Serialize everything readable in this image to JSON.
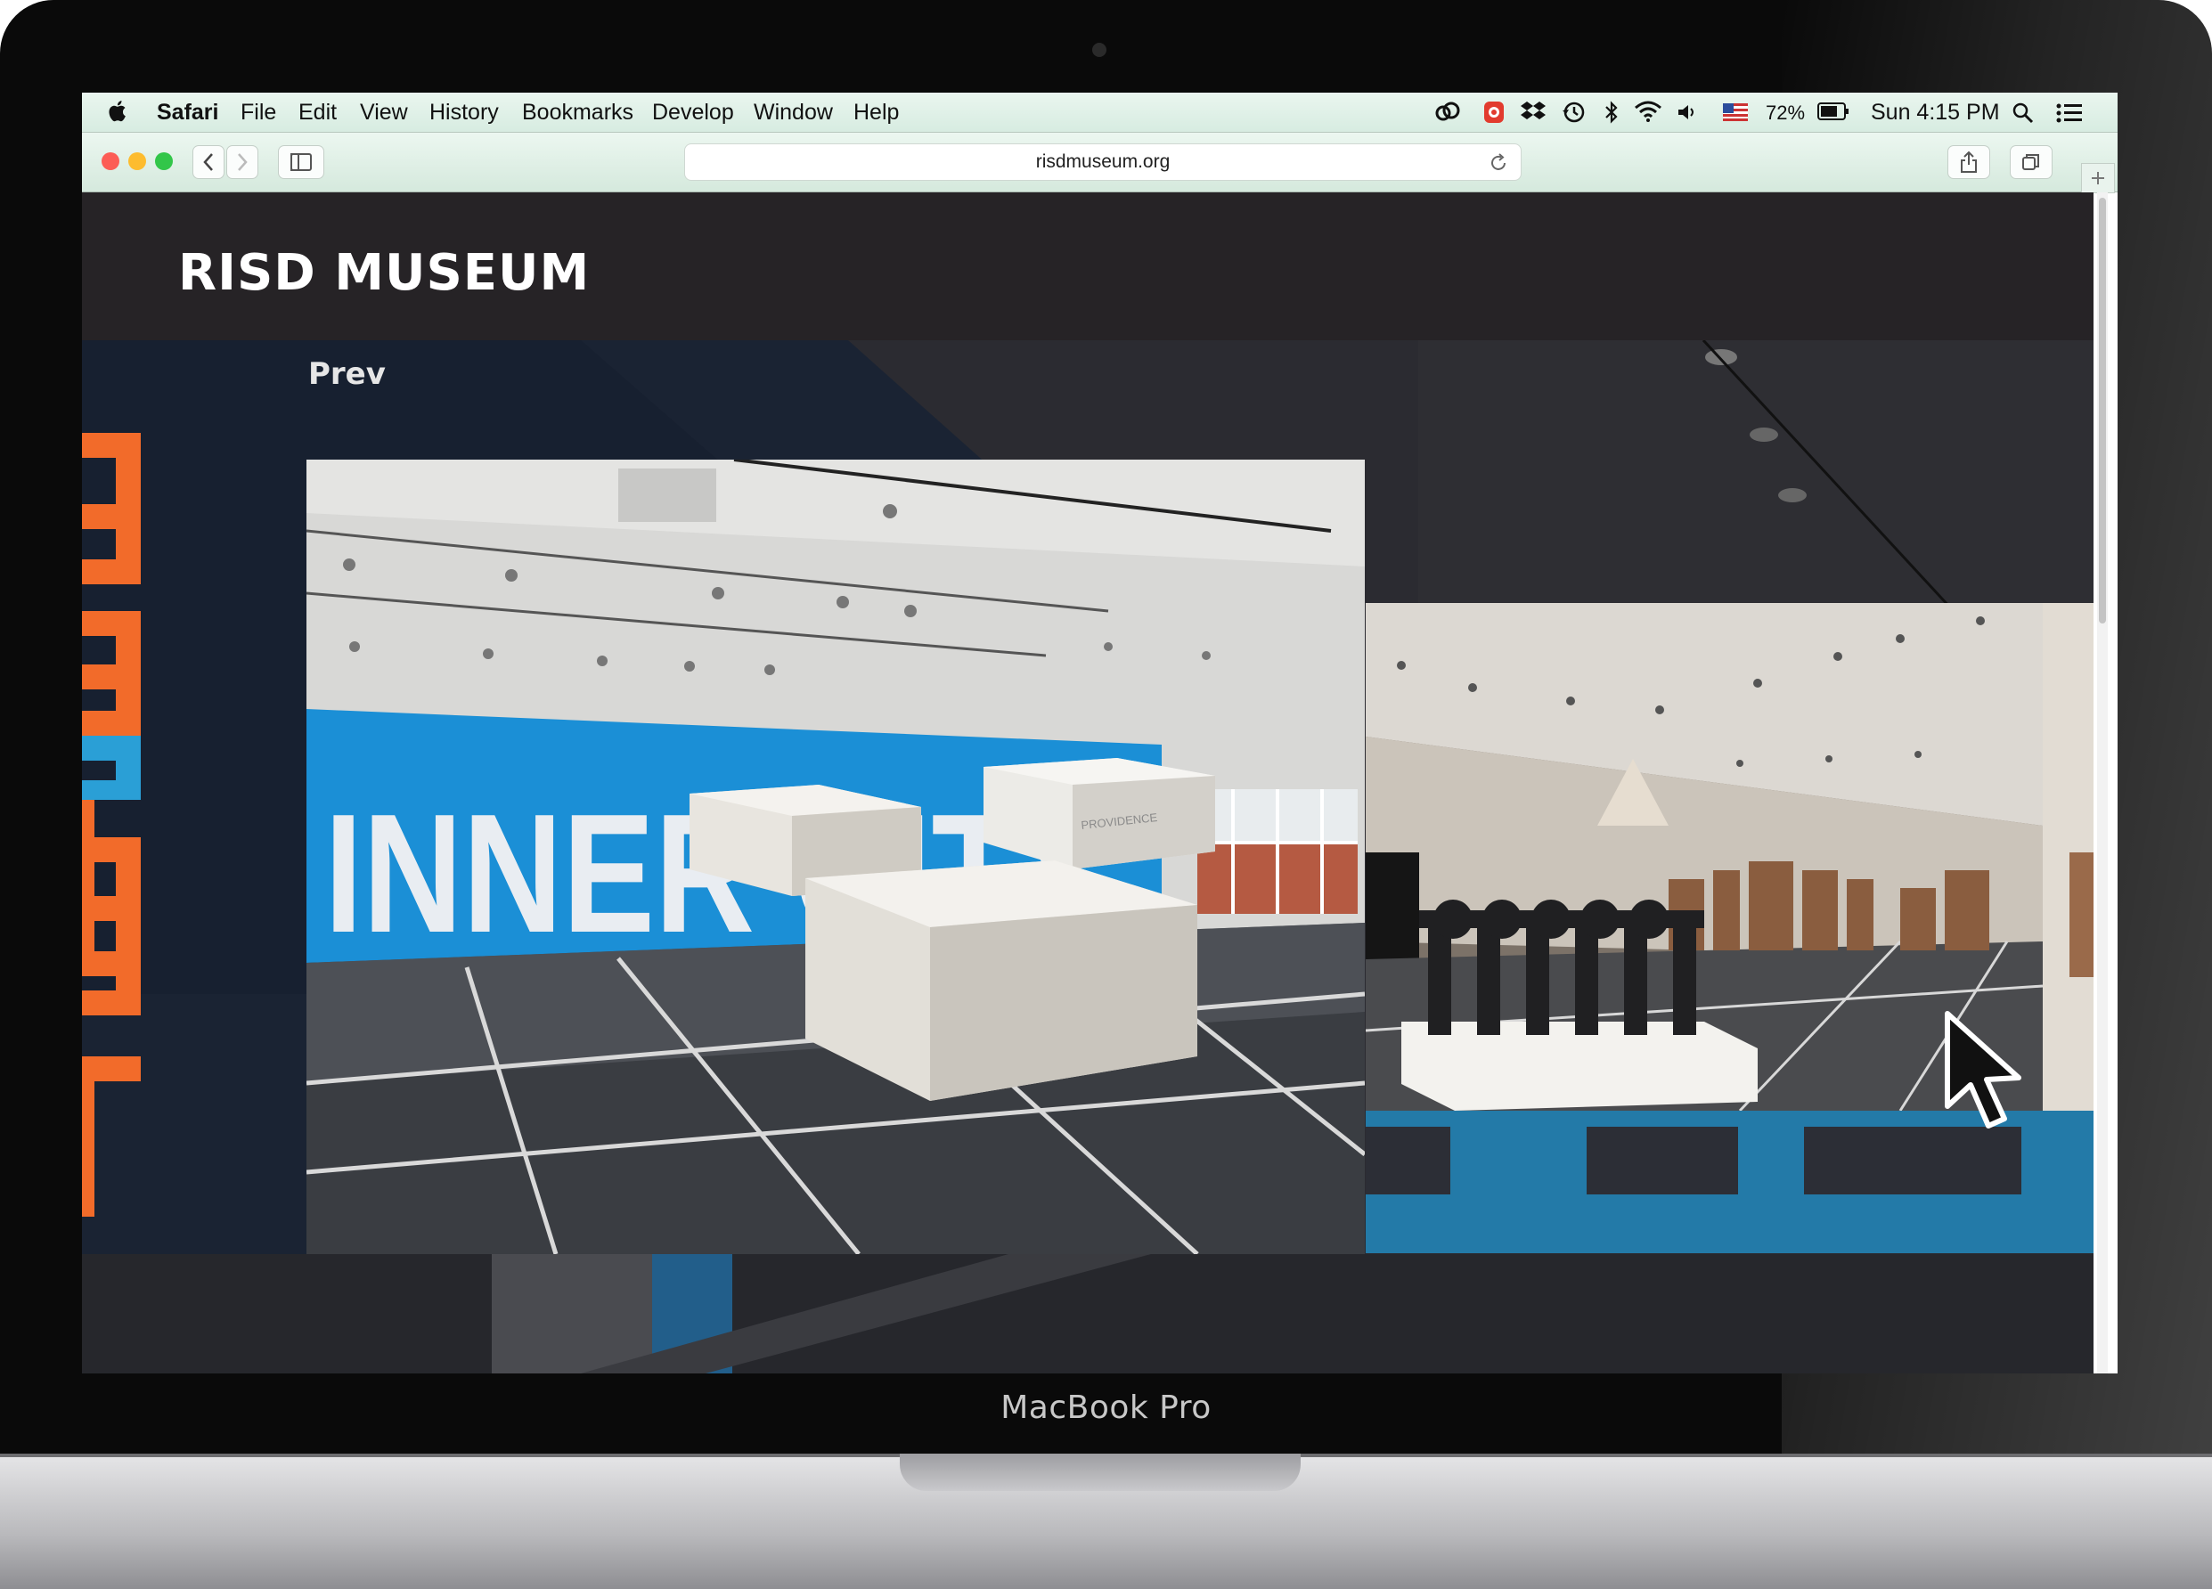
{
  "menubar": {
    "app_name": "Safari",
    "items": [
      "File",
      "Edit",
      "View",
      "History",
      "Bookmarks",
      "Develop",
      "Window",
      "Help"
    ],
    "battery": "72%",
    "clock": "Sun 4:15 PM"
  },
  "browser": {
    "url": "risdmuseum.org"
  },
  "site": {
    "logo": "RISD MUSEUM",
    "prev_label": "Prev",
    "main_slide": {
      "wall_text": "INNER CITY",
      "pedestal_text": "PROVIDENCE"
    }
  },
  "device": {
    "model": "MacBook Pro"
  },
  "colors": {
    "accent_orange": "#f26b2a",
    "accent_blue": "#2a9fd6",
    "wall_blue": "#1b8fd6",
    "header_bg": "#262326",
    "menubar_bg": "#d7ece1"
  },
  "icons": [
    "apple-icon",
    "creative-cloud-icon",
    "record-icon",
    "dropbox-icon",
    "time-machine-icon",
    "bluetooth-icon",
    "wifi-icon",
    "volume-icon",
    "flag-icon",
    "battery-icon",
    "spotlight-icon",
    "notification-center-icon",
    "back-icon",
    "forward-icon",
    "sidebar-icon",
    "reload-icon",
    "share-icon",
    "tabs-icon",
    "new-tab-icon",
    "cursor-arrow-icon"
  ]
}
